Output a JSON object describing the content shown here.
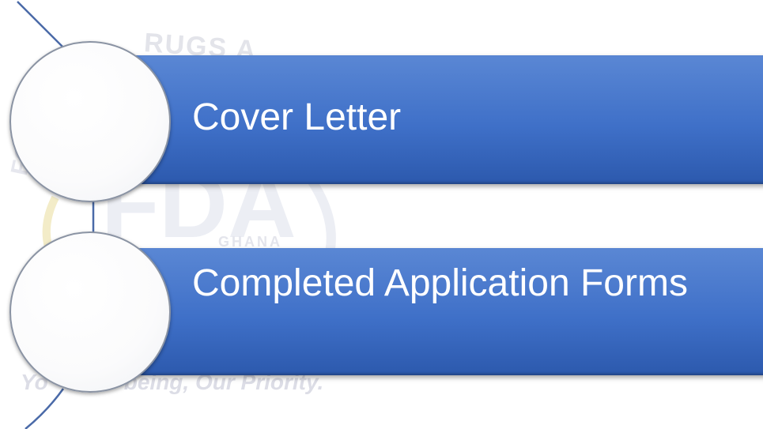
{
  "watermark": {
    "top_text": "RUGS A",
    "side_text": "FO",
    "logo_text": "FDA",
    "country_text": "GHANA",
    "tagline_left": "Yo",
    "tagline_right": "being, Our Priority."
  },
  "list": {
    "items": [
      {
        "label": "Cover Letter"
      },
      {
        "label": "Completed Application Forms"
      }
    ]
  },
  "colors": {
    "bar_top": "#5a87d4",
    "bar_bottom": "#2c59ad",
    "circle_fill": "#ffffff",
    "circle_border": "#8a93a3",
    "text": "#ffffff"
  }
}
